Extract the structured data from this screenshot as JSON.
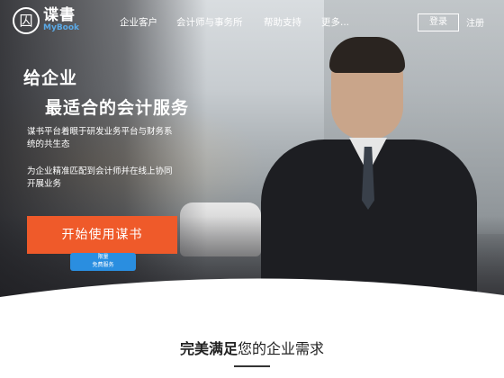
{
  "nav": {
    "logo_cn": "谍書",
    "logo_en": "MyBook",
    "links": [
      "企业客户",
      "会计师与事务所",
      "帮助支持",
      "更多..."
    ],
    "login": "登录",
    "register": "注册"
  },
  "hero": {
    "headline_line1": "给企业",
    "headline_line2": "最适合的会计服务",
    "sub1": "谋书平台着眼于研发业务平台与财务系统的共生态",
    "sub2": "为企业精准匹配到会计师并在线上协同开展业务",
    "cta": "开始使用谋书",
    "trial_line1": "限量",
    "trial_line2": "免费服务"
  },
  "section": {
    "title_strong": "完美满足",
    "title_rest": "您的企业需求"
  },
  "colors": {
    "cta": "#ef5a2a",
    "trial": "#2a8ee0"
  }
}
